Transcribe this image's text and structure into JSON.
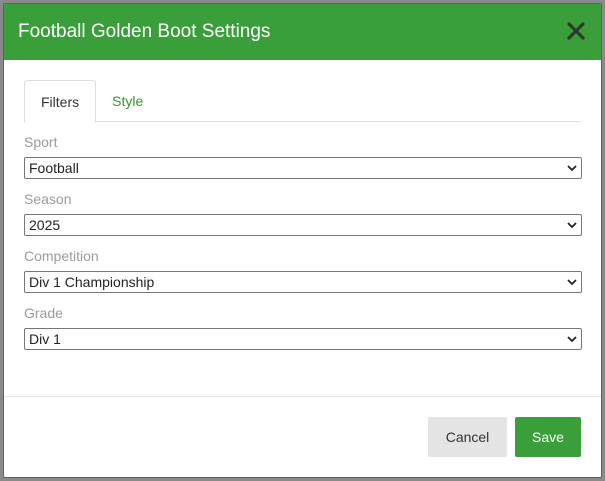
{
  "colors": {
    "header_bg": "#3a9e3a",
    "accent_green": "#2e9a2e",
    "label_gray": "#9b9b9b"
  },
  "modal": {
    "title": "Football Golden Boot Settings",
    "close_icon": "close-x-icon"
  },
  "tabs": [
    {
      "label": "Filters",
      "active": true
    },
    {
      "label": "Style",
      "active": false
    }
  ],
  "fields": {
    "sport": {
      "label": "Sport",
      "value": "Football"
    },
    "season": {
      "label": "Season",
      "value": "2025"
    },
    "competition": {
      "label": "Competition",
      "value": "Div 1 Championship"
    },
    "grade": {
      "label": "Grade",
      "value": "Div 1"
    }
  },
  "footer": {
    "cancel_label": "Cancel",
    "save_label": "Save"
  }
}
